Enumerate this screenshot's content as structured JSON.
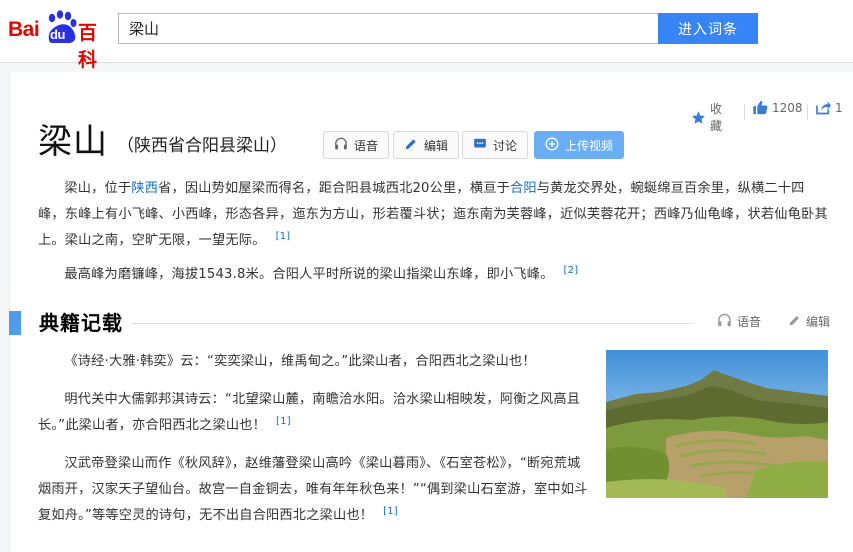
{
  "header": {
    "logo": {
      "bai": "Bai",
      "du": "du",
      "baike": "百科"
    },
    "search_value": "梁山",
    "enter_button": "进入词条"
  },
  "actions": {
    "collect_label": "收藏",
    "like_count": "1208",
    "share_count": "1"
  },
  "title": {
    "main": "梁山",
    "subtitle": "（陕西省合阳县梁山）"
  },
  "toolbar": {
    "voice": "语音",
    "edit": "编辑",
    "discuss": "讨论",
    "upload_video": "上传视频"
  },
  "intro": {
    "p1_a": "梁山，位于",
    "p1_link1": "陕西",
    "p1_b": "省，因山势如屋梁而得名，距合阳县城西北20公里，横亘于",
    "p1_link2": "合阳",
    "p1_c": "与黄龙交界处，蜿蜒绵亘百余里，纵横二十四峰，东峰上有小飞峰、小西峰，形态各异，迤东为方山，形若覆斗状；迤东南为芙蓉峰，近似芙蓉花开；西峰乃仙龟峰，状若仙龟卧其上。梁山之南，空旷无限，一望无际。",
    "p1_ref": "[1]",
    "p2": "最高峰为磨镰峰，海拔1543.8米。合阳人平时所说的梁山指梁山东峰，即小飞峰。",
    "p2_ref": "[2]"
  },
  "section": {
    "title": "典籍记载",
    "voice": "语音",
    "edit": "编辑",
    "p1": "《诗经·大雅·韩奕》云：“奕奕梁山，维禹甸之。”此梁山者，合阳西北之梁山也！",
    "p2": "明代关中大儒郭邦淇诗云：“北望梁山麓，南瞻洽水阳。洽水梁山相映发，阿衡之风高且长。”此梁山者，亦合阳西北之梁山也！",
    "p2_ref": "[1]",
    "p3": "汉武帝登梁山而作《秋风辞》，赵维藩登梁山高吟《梁山暮雨》、《石室苍松》，“断宛荒城烟雨开，汉家天子望仙台。故宫一自金铜去，唯有年年秋色来！”“偶到梁山石室游，室中如斗复如舟。”等等空灵的诗句，无不出自合阳西北之梁山也！",
    "p3_ref": "[1]"
  },
  "colors": {
    "brand_red": "#e10601",
    "brand_blue": "#3885f7",
    "link": "#136ec2",
    "section_bar": "#4f9cee"
  }
}
